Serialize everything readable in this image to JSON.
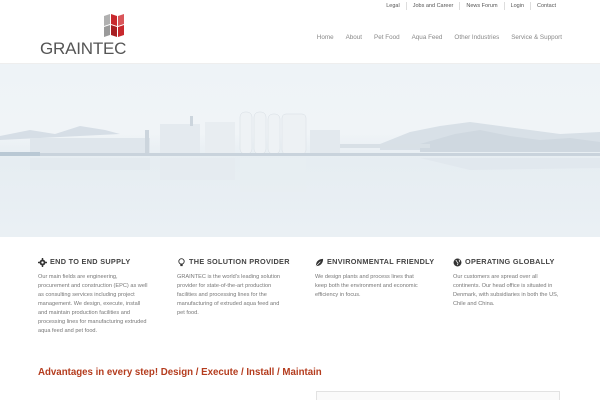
{
  "topbar": {
    "links": [
      "Legal",
      "Jobs and Career",
      "News Forum",
      "Login",
      "Contact"
    ]
  },
  "logo": {
    "text": "GRAINTEC"
  },
  "nav": {
    "items": [
      "Home",
      "About",
      "Pet Food",
      "Aqua Feed",
      "Other Industries",
      "Service & Support"
    ]
  },
  "features": [
    {
      "icon": "gear-icon",
      "title": "END TO END SUPPLY",
      "text": "Our main fields are engineering, procurement and construction (EPC) as well as consulting services including project management. We design, execute, install and maintain production facilities and processing lines for manufacturing extruded aqua feed and pet food."
    },
    {
      "icon": "lightbulb-icon",
      "title": "THE SOLUTION PROVIDER",
      "text": "GRAINTEC is the world's leading solution provider for state-of-the-art production facilities and processing lines for the manufacturing of extruded aqua feed and pet food."
    },
    {
      "icon": "leaf-icon",
      "title": "ENVIRONMENTAL FRIENDLY",
      "text": "We design plants and process lines that keep both the environment and economic efficiency in focus."
    },
    {
      "icon": "globe-icon",
      "title": "OPERATING GLOBALLY",
      "text": "Our customers are spread over all continents. Our head office is situated in Denmark, with subsidiaries in both the US, Chile and China."
    }
  ],
  "advantages": {
    "title": "Advantages in every step! Design / Execute / Install / Maintain"
  },
  "colors": {
    "accent": "#b43c1e",
    "logo_red": "#c8282d",
    "logo_grey": "#9a9a9a"
  }
}
